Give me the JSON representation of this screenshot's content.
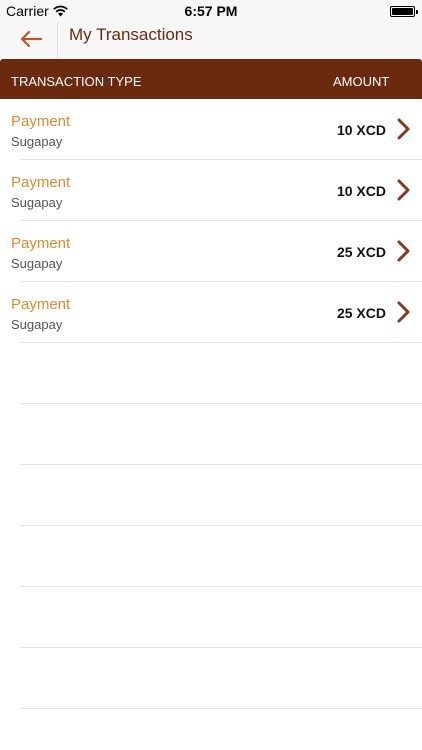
{
  "status_bar": {
    "carrier": "Carrier",
    "time": "6:57 PM",
    "icons": [
      "wifi-icon",
      "battery-icon"
    ]
  },
  "nav": {
    "back_icon": "arrow-left-icon",
    "title": "My Transactions"
  },
  "table": {
    "header_type": "TRANSACTION TYPE",
    "header_amount": "AMOUNT",
    "rows": [
      {
        "type": "Payment",
        "provider": "Sugapay",
        "amount": "10 XCD"
      },
      {
        "type": "Payment",
        "provider": "Sugapay",
        "amount": "10 XCD"
      },
      {
        "type": "Payment",
        "provider": "Sugapay",
        "amount": "25 XCD"
      },
      {
        "type": "Payment",
        "provider": "Sugapay",
        "amount": "25 XCD"
      }
    ],
    "row_icon": "chevron-right-icon"
  },
  "colors": {
    "accent": "#e08a2e",
    "header_bg": "#6b2a0d",
    "title": "#6b2a12",
    "chevron": "#8a3a1c"
  }
}
